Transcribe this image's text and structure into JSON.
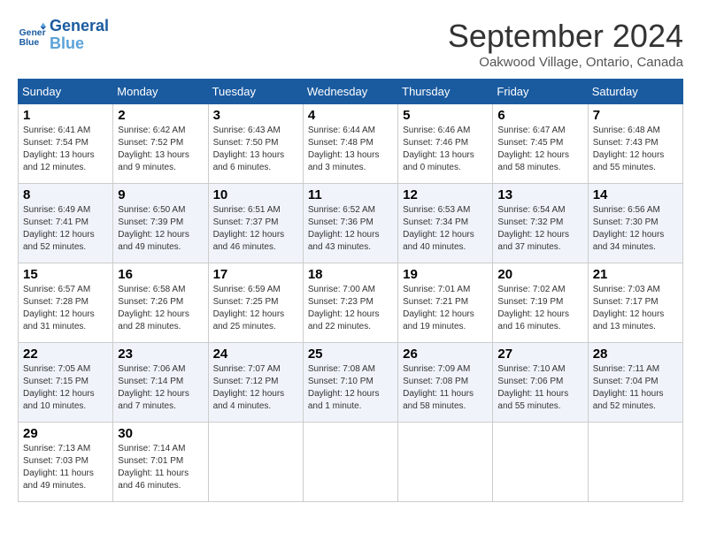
{
  "header": {
    "logo_line1": "General",
    "logo_line2": "Blue",
    "month": "September 2024",
    "location": "Oakwood Village, Ontario, Canada"
  },
  "weekdays": [
    "Sunday",
    "Monday",
    "Tuesday",
    "Wednesday",
    "Thursday",
    "Friday",
    "Saturday"
  ],
  "weeks": [
    [
      {
        "num": "1",
        "sunrise": "6:41 AM",
        "sunset": "7:54 PM",
        "daylight": "13 hours and 12 minutes."
      },
      {
        "num": "2",
        "sunrise": "6:42 AM",
        "sunset": "7:52 PM",
        "daylight": "13 hours and 9 minutes."
      },
      {
        "num": "3",
        "sunrise": "6:43 AM",
        "sunset": "7:50 PM",
        "daylight": "13 hours and 6 minutes."
      },
      {
        "num": "4",
        "sunrise": "6:44 AM",
        "sunset": "7:48 PM",
        "daylight": "13 hours and 3 minutes."
      },
      {
        "num": "5",
        "sunrise": "6:46 AM",
        "sunset": "7:46 PM",
        "daylight": "13 hours and 0 minutes."
      },
      {
        "num": "6",
        "sunrise": "6:47 AM",
        "sunset": "7:45 PM",
        "daylight": "12 hours and 58 minutes."
      },
      {
        "num": "7",
        "sunrise": "6:48 AM",
        "sunset": "7:43 PM",
        "daylight": "12 hours and 55 minutes."
      }
    ],
    [
      {
        "num": "8",
        "sunrise": "6:49 AM",
        "sunset": "7:41 PM",
        "daylight": "12 hours and 52 minutes."
      },
      {
        "num": "9",
        "sunrise": "6:50 AM",
        "sunset": "7:39 PM",
        "daylight": "12 hours and 49 minutes."
      },
      {
        "num": "10",
        "sunrise": "6:51 AM",
        "sunset": "7:37 PM",
        "daylight": "12 hours and 46 minutes."
      },
      {
        "num": "11",
        "sunrise": "6:52 AM",
        "sunset": "7:36 PM",
        "daylight": "12 hours and 43 minutes."
      },
      {
        "num": "12",
        "sunrise": "6:53 AM",
        "sunset": "7:34 PM",
        "daylight": "12 hours and 40 minutes."
      },
      {
        "num": "13",
        "sunrise": "6:54 AM",
        "sunset": "7:32 PM",
        "daylight": "12 hours and 37 minutes."
      },
      {
        "num": "14",
        "sunrise": "6:56 AM",
        "sunset": "7:30 PM",
        "daylight": "12 hours and 34 minutes."
      }
    ],
    [
      {
        "num": "15",
        "sunrise": "6:57 AM",
        "sunset": "7:28 PM",
        "daylight": "12 hours and 31 minutes."
      },
      {
        "num": "16",
        "sunrise": "6:58 AM",
        "sunset": "7:26 PM",
        "daylight": "12 hours and 28 minutes."
      },
      {
        "num": "17",
        "sunrise": "6:59 AM",
        "sunset": "7:25 PM",
        "daylight": "12 hours and 25 minutes."
      },
      {
        "num": "18",
        "sunrise": "7:00 AM",
        "sunset": "7:23 PM",
        "daylight": "12 hours and 22 minutes."
      },
      {
        "num": "19",
        "sunrise": "7:01 AM",
        "sunset": "7:21 PM",
        "daylight": "12 hours and 19 minutes."
      },
      {
        "num": "20",
        "sunrise": "7:02 AM",
        "sunset": "7:19 PM",
        "daylight": "12 hours and 16 minutes."
      },
      {
        "num": "21",
        "sunrise": "7:03 AM",
        "sunset": "7:17 PM",
        "daylight": "12 hours and 13 minutes."
      }
    ],
    [
      {
        "num": "22",
        "sunrise": "7:05 AM",
        "sunset": "7:15 PM",
        "daylight": "12 hours and 10 minutes."
      },
      {
        "num": "23",
        "sunrise": "7:06 AM",
        "sunset": "7:14 PM",
        "daylight": "12 hours and 7 minutes."
      },
      {
        "num": "24",
        "sunrise": "7:07 AM",
        "sunset": "7:12 PM",
        "daylight": "12 hours and 4 minutes."
      },
      {
        "num": "25",
        "sunrise": "7:08 AM",
        "sunset": "7:10 PM",
        "daylight": "12 hours and 1 minute."
      },
      {
        "num": "26",
        "sunrise": "7:09 AM",
        "sunset": "7:08 PM",
        "daylight": "11 hours and 58 minutes."
      },
      {
        "num": "27",
        "sunrise": "7:10 AM",
        "sunset": "7:06 PM",
        "daylight": "11 hours and 55 minutes."
      },
      {
        "num": "28",
        "sunrise": "7:11 AM",
        "sunset": "7:04 PM",
        "daylight": "11 hours and 52 minutes."
      }
    ],
    [
      {
        "num": "29",
        "sunrise": "7:13 AM",
        "sunset": "7:03 PM",
        "daylight": "11 hours and 49 minutes."
      },
      {
        "num": "30",
        "sunrise": "7:14 AM",
        "sunset": "7:01 PM",
        "daylight": "11 hours and 46 minutes."
      },
      null,
      null,
      null,
      null,
      null
    ]
  ]
}
